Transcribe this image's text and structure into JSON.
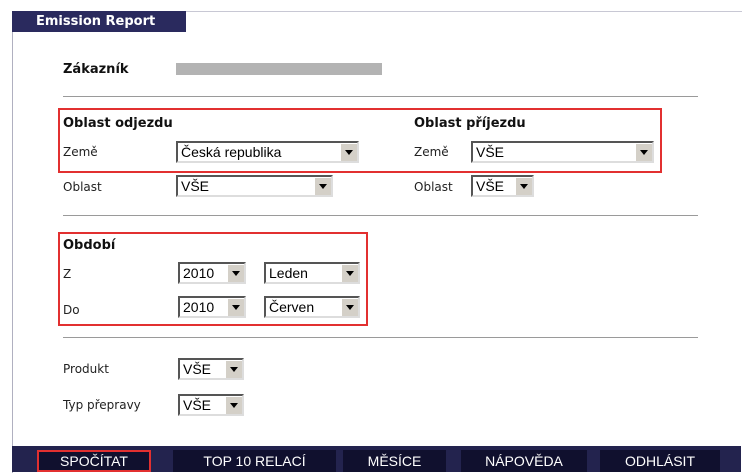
{
  "tab": {
    "title": "Emission Report"
  },
  "customer": {
    "label": "Zákazník"
  },
  "departure": {
    "heading": "Oblast odjezdu",
    "country_label": "Země",
    "country_value": "Česká republika",
    "region_label": "Oblast",
    "region_value": "VŠE"
  },
  "arrival": {
    "heading": "Oblast příjezdu",
    "country_label": "Země",
    "country_value": "VŠE",
    "region_label": "Oblast",
    "region_value": "VŠE"
  },
  "period": {
    "heading": "Období",
    "from_label": "Z",
    "from_year": "2010",
    "from_month": "Leden",
    "to_label": "Do",
    "to_year": "2010",
    "to_month": "Červen"
  },
  "filters": {
    "product_label": "Produkt",
    "product_value": "VŠE",
    "transport_label": "Typ přepravy",
    "transport_value": "VŠE"
  },
  "nav": {
    "calculate": "SPOČÍTAT",
    "top10": "TOP 10 RELACÍ",
    "months": "MĚSÍCE",
    "help": "NÁPOVĚDA",
    "logout": "ODHLÁSIT"
  },
  "colors": {
    "header_bg": "#2a2a5e",
    "nav_bg": "#23234e",
    "button_bg": "#10102e",
    "highlight": "#e23030"
  }
}
